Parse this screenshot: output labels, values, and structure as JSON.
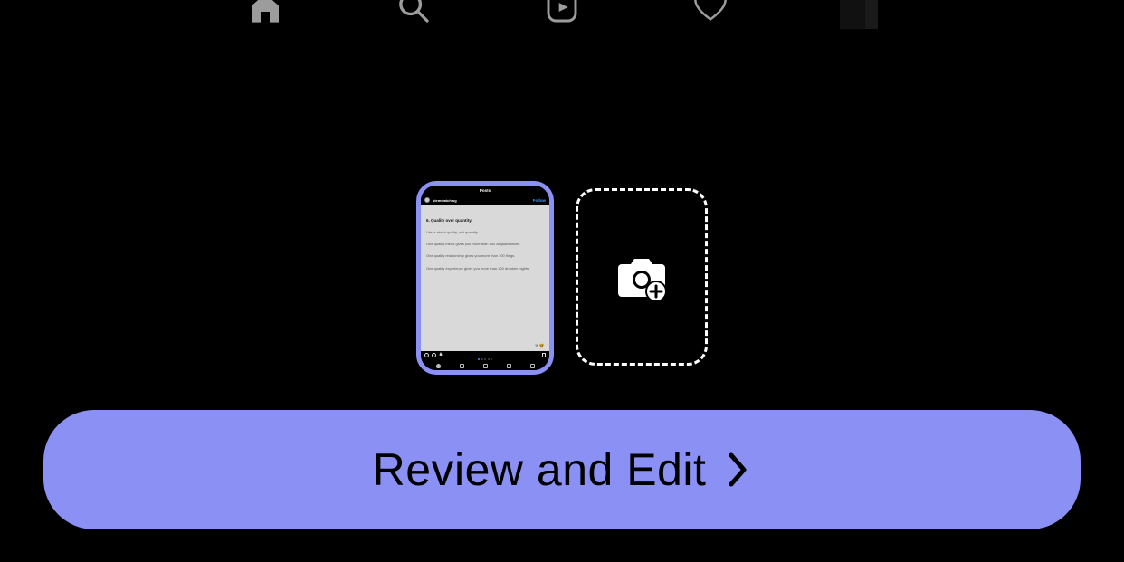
{
  "colors": {
    "accent": "#8b90f4"
  },
  "nav": {
    "items": [
      "home-icon",
      "search-icon",
      "reels-icon",
      "heart-icon",
      "avatar"
    ]
  },
  "thumbnails": {
    "selected": {
      "top_label": "Posts",
      "username": "stemwatching",
      "follow_label": "Follow",
      "heading": "6. Quality over quantity.",
      "lines": [
        "Life is about quality, not quantity.",
        "One quality friend gives you more than 100 acquaintances.",
        "One quality relationship gives you more than 100 flings.",
        "One quality experience gives you more than 100 drunken nights."
      ],
      "corner": "% 🤓"
    },
    "add_icon": "camera-plus-icon"
  },
  "cta": {
    "label": "Review and Edit",
    "chevron": "chevron-right-icon"
  }
}
